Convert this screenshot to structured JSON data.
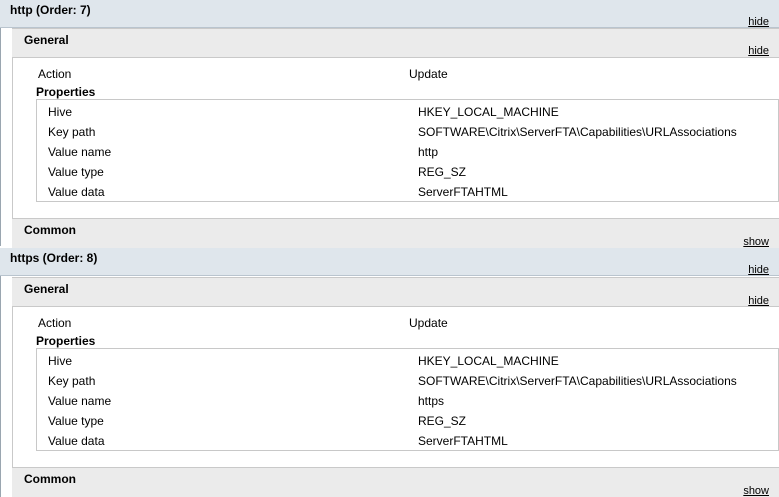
{
  "sections": [
    {
      "title": "http (Order: 7)",
      "hide_label": "hide",
      "general": {
        "title": "General",
        "hide_label": "hide",
        "action_label": "Action",
        "action_value": "Update",
        "properties_label": "Properties",
        "rows": [
          {
            "key": "Hive",
            "value": "HKEY_LOCAL_MACHINE"
          },
          {
            "key": "Key path",
            "value": "SOFTWARE\\Citrix\\ServerFTA\\Capabilities\\URLAssociations"
          },
          {
            "key": "Value name",
            "value": "http"
          },
          {
            "key": "Value type",
            "value": "REG_SZ"
          },
          {
            "key": "Value data",
            "value": "ServerFTAHTML"
          }
        ]
      },
      "common": {
        "title": "Common",
        "show_label": "show"
      }
    },
    {
      "title": "https (Order: 8)",
      "hide_label": "hide",
      "general": {
        "title": "General",
        "hide_label": "hide",
        "action_label": "Action",
        "action_value": "Update",
        "properties_label": "Properties",
        "rows": [
          {
            "key": "Hive",
            "value": "HKEY_LOCAL_MACHINE"
          },
          {
            "key": "Key path",
            "value": "SOFTWARE\\Citrix\\ServerFTA\\Capabilities\\URLAssociations"
          },
          {
            "key": "Value name",
            "value": "https"
          },
          {
            "key": "Value type",
            "value": "REG_SZ"
          },
          {
            "key": "Value data",
            "value": "ServerFTAHTML"
          }
        ]
      },
      "common": {
        "title": "Common",
        "show_label": "show"
      }
    }
  ]
}
